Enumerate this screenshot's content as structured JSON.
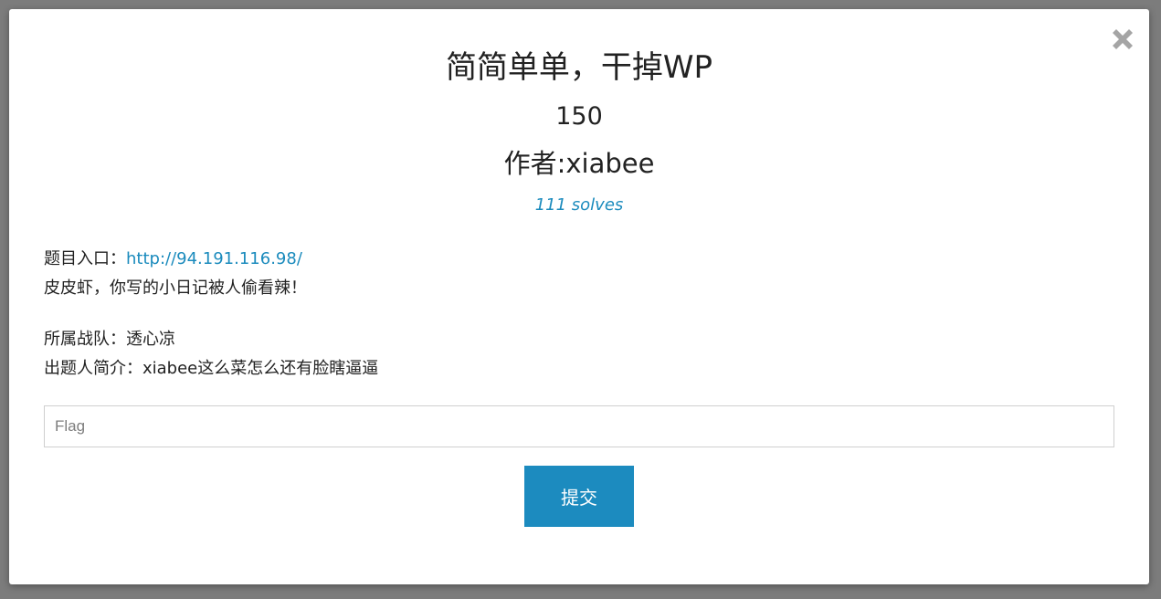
{
  "challenge": {
    "title": "简简单单，干掉WP",
    "points": "150",
    "author_prefix": "作者:",
    "author_name": "xiabee",
    "solves": "111 solves"
  },
  "description": {
    "entry_label": "题目入口：",
    "entry_link": "http://94.191.116.98/",
    "text": "皮皮虾，你写的小日记被人偷看辣！"
  },
  "meta": {
    "team_line": "所属战队：透心凉",
    "bio_line": "出题人简介：xiabee这么菜怎么还有脸瞎逼逼"
  },
  "form": {
    "flag_placeholder": "Flag",
    "flag_value": "",
    "submit_label": "提交"
  },
  "icons": {
    "close": "close-icon"
  },
  "colors": {
    "accent": "#1c8bbf",
    "link": "#1b8bbd",
    "backdrop": "#7c7c7c"
  }
}
